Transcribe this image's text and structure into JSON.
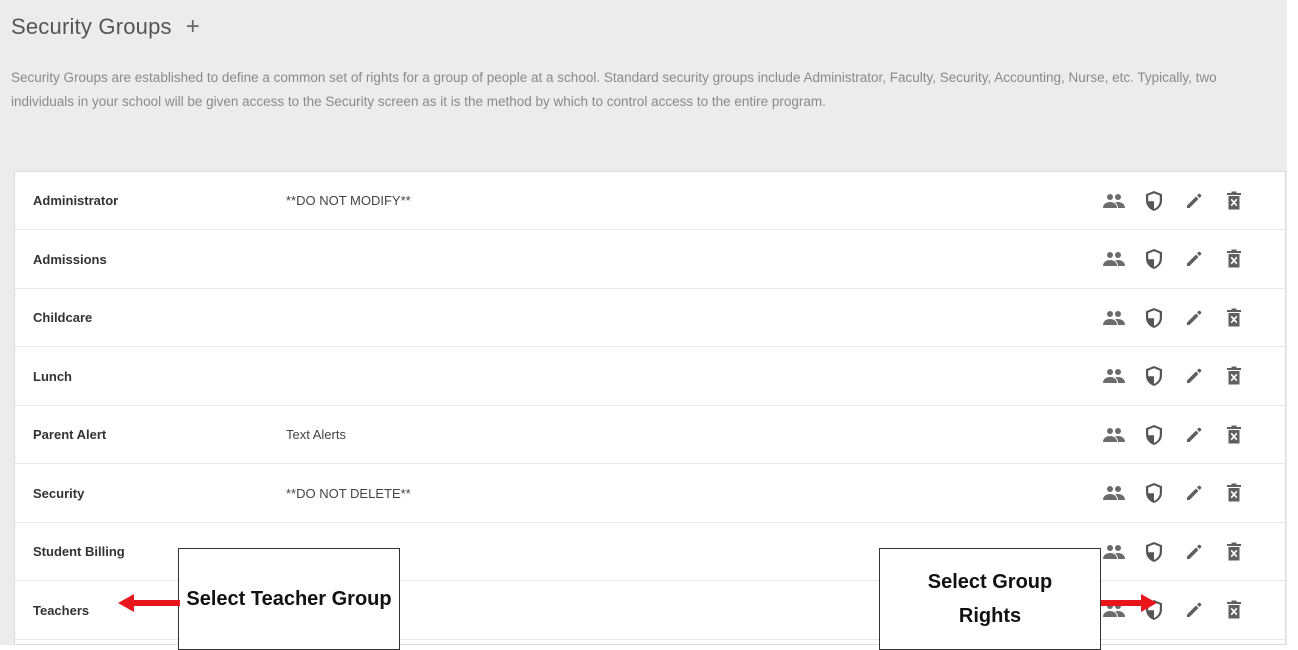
{
  "header": {
    "title": "Security Groups",
    "add_label": "+"
  },
  "description": "Security Groups are established to define a common set of rights for a group of people at a school. Standard security groups include Administrator, Faculty, Security, Accounting, Nurse, etc. Typically, two individuals in your school will be given access to the Security screen as it is the method by which to control access to the entire program.",
  "rows": [
    {
      "name": "Administrator",
      "note": "**DO NOT MODIFY**"
    },
    {
      "name": "Admissions",
      "note": ""
    },
    {
      "name": "Childcare",
      "note": ""
    },
    {
      "name": "Lunch",
      "note": ""
    },
    {
      "name": "Parent Alert",
      "note": "Text Alerts"
    },
    {
      "name": "Security",
      "note": "**DO NOT DELETE**"
    },
    {
      "name": "Student Billing",
      "note": ""
    },
    {
      "name": "Teachers",
      "note": ""
    }
  ],
  "icons": {
    "members": "people-icon",
    "rights": "shield-icon",
    "edit": "pencil-icon",
    "delete": "trash-icon"
  },
  "annotations": {
    "teacher": "Select Teacher Group",
    "rights": "Select Group Rights",
    "arrow_color": "#e8161b"
  }
}
